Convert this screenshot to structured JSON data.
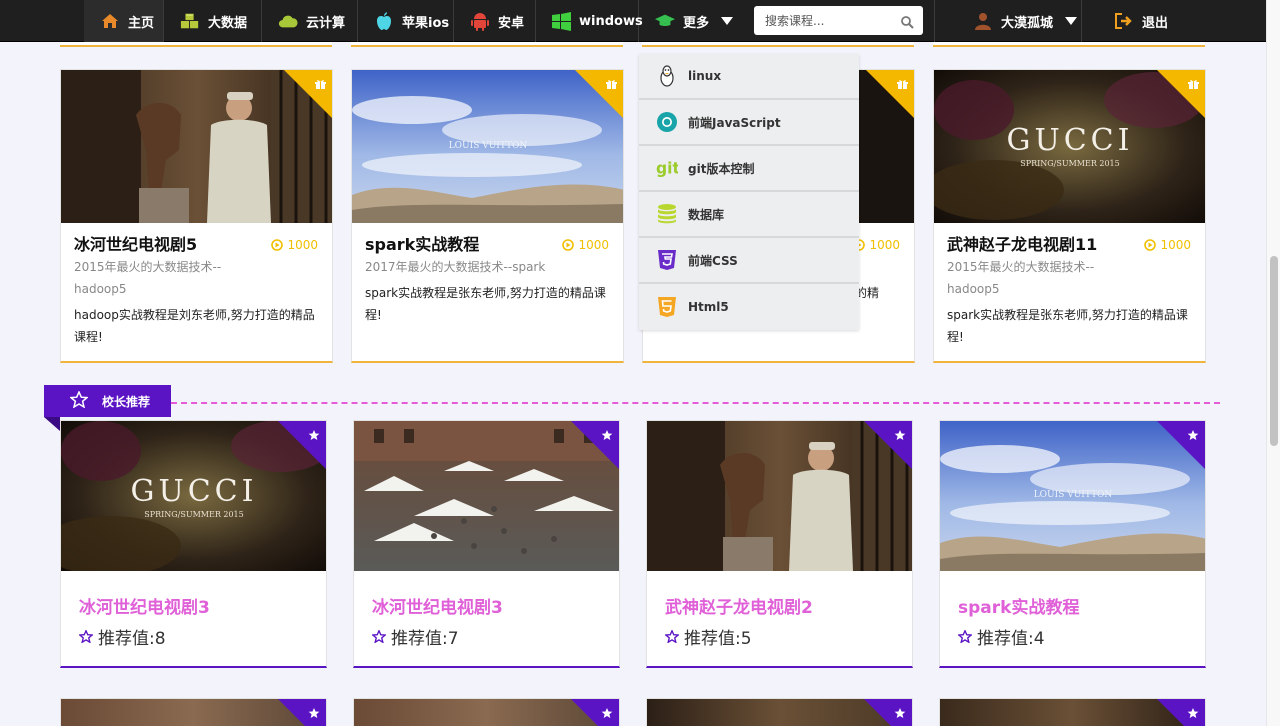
{
  "nav": {
    "items": [
      {
        "label": "主页",
        "icon": "home-icon"
      },
      {
        "label": "大数据",
        "icon": "cubes-icon"
      },
      {
        "label": "云计算",
        "icon": "cloud-icon"
      },
      {
        "label": "苹果ios",
        "icon": "apple-icon"
      },
      {
        "label": "安卓",
        "icon": "android-icon"
      },
      {
        "label": "windows",
        "icon": "windows-icon"
      },
      {
        "label": "更多",
        "icon": "graduation-cap-icon"
      }
    ],
    "search_placeholder": "搜索课程...",
    "user_name": "大漠孤城",
    "logout_label": "退出"
  },
  "dropdown": [
    {
      "label": "linux",
      "icon": "linux-icon"
    },
    {
      "label": "前端JavaScript",
      "icon": "chrome-icon"
    },
    {
      "label": "git版本控制",
      "icon": "git-icon"
    },
    {
      "label": "数据库",
      "icon": "database-icon"
    },
    {
      "label": "前端CSS",
      "icon": "css3-icon"
    },
    {
      "label": "Html5",
      "icon": "html5-icon"
    }
  ],
  "top_cards": [
    {
      "title": "冰河世纪电视剧5",
      "views": "1000",
      "subtitle": "2015年最火的大数据技术--hadoop5",
      "desc": "hadoop实战教程是刘东老师,努力打造的精品课程!"
    },
    {
      "title": "spark实战教程",
      "views": "1000",
      "subtitle": "2017年最火的大数据技术--spark",
      "desc": "spark实战教程是张东老师,努力打造的精品课程!"
    },
    {
      "title": "",
      "views": "1000",
      "subtitle": "",
      "desc": "的精"
    },
    {
      "title": "武神赵子龙电视剧11",
      "views": "1000",
      "subtitle": "2015年最火的大数据技术--hadoop5",
      "desc": "spark实战教程是张东老师,努力打造的精品课程!"
    }
  ],
  "section": {
    "label": "校长推荐"
  },
  "rec_cards": [
    {
      "title": "冰河世纪电视剧3",
      "value": "推荐值:8"
    },
    {
      "title": "冰河世纪电视剧3",
      "value": "推荐值:7"
    },
    {
      "title": "武神赵子龙电视剧2",
      "value": "推荐值:5"
    },
    {
      "title": "spark实战教程",
      "value": "推荐值:4"
    }
  ],
  "thumb_text": {
    "gucci": "GUCCI",
    "gucci_sub": "SPRING/SUMMER 2015",
    "lv": "LOUIS VUITTON"
  },
  "colors": {
    "gold_accent": "#f5b800",
    "purple_accent": "#5b14c4",
    "pink_title": "#e060d8"
  }
}
